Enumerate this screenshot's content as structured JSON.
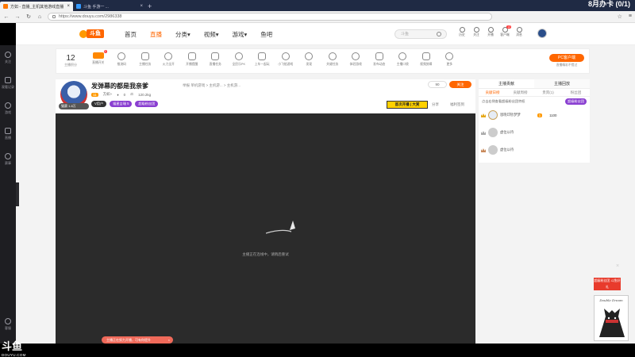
{
  "browser": {
    "tabs": [
      {
        "title": "方如 - 直播_主机其他游戏直播"
      },
      {
        "title": "斗鱼 手游一 ..."
      }
    ],
    "new_tab": "+",
    "address": "https://www.douyu.com/2986338",
    "overlay": "8月办卡 (0/1)"
  },
  "site": {
    "logo_text": "斗鱼",
    "nav": [
      {
        "label": "首页"
      },
      {
        "label": "直播"
      },
      {
        "label": "分类▾"
      },
      {
        "label": "视频▾"
      },
      {
        "label": "游戏▾"
      },
      {
        "label": "鱼吧"
      }
    ],
    "search_placeholder": "斗鱼",
    "header_tools": [
      {
        "label": "历史"
      },
      {
        "label": "关注"
      },
      {
        "label": "开播"
      },
      {
        "label": "客户端",
        "badge": "12"
      },
      {
        "label": "消息"
      }
    ]
  },
  "left_sidebar": {
    "items": [
      {
        "label": "关注"
      },
      {
        "label": "观看记录"
      },
      {
        "label": "游戏"
      },
      {
        "label": "直播"
      },
      {
        "label": "赛事"
      }
    ],
    "bottom": {
      "label": "客服"
    }
  },
  "toolbar": {
    "level_number": "12",
    "level_label": "主播积分",
    "items": [
      {
        "label": "直播开关",
        "badge": "3"
      },
      {
        "label": "推流码"
      },
      {
        "label": "主播任务"
      },
      {
        "label": "火力全开"
      },
      {
        "label": "开播提醒"
      },
      {
        "label": "直播任务"
      },
      {
        "label": "全民乐PK"
      },
      {
        "label": "上车一起玩"
      },
      {
        "label": "小飞船游戏"
      },
      {
        "label": "发现"
      },
      {
        "label": "关键任务"
      },
      {
        "label": "体验游戏"
      },
      {
        "label": "发布动态"
      },
      {
        "label": "主播口袋"
      },
      {
        "label": "视频剪辑"
      },
      {
        "label": "更多"
      }
    ],
    "pc_button": "PC客户端",
    "pc_sub": "直播精彩不错过"
  },
  "room": {
    "title": "发弹幕的都是我亲爹",
    "meta": "举报   单机游戏 > 主机游... > 主机游...",
    "level": "11",
    "anchor_name": "方如~",
    "fans": "0",
    "heat": "120.2kg",
    "anchor_badge": "猫赛 1.8万",
    "pills": [
      "V用户",
      "福星吉瑞 5",
      "超级粉丝团"
    ],
    "follow_count": "90",
    "follow_label": "关注",
    "promo": "首次开播 | 大赏",
    "share": "分享",
    "report": "福利签到"
  },
  "player": {
    "offline_message": "主播正在连线中，请稍后重试",
    "toast": "主播正在努力开播，可有你提升"
  },
  "right_panel": {
    "tabs1": [
      "主播贡献",
      "主播回放"
    ],
    "tabs2": [
      "贡献日榜",
      "贡献周榜",
      "贵宾(1)",
      "粉丝团"
    ],
    "notice": "点击右侧查看超级粉丝团特权",
    "fan_button": "超级粉丝团",
    "rank": [
      {
        "name": "恩晓印钞梦梦",
        "badge": "1",
        "score": "1100"
      },
      {
        "name": "虚位以待"
      },
      {
        "name": "虚位以待"
      }
    ]
  },
  "right_float": {
    "banner": "超级粉丝团 斗鱼好礼",
    "card_name": "Double Dream",
    "close": "×"
  },
  "watermark": {
    "big": "斗鱼",
    "small": "DOUYU.COM"
  },
  "colors": {
    "accent": "#ff6600",
    "tab_bg": "#1f2a44",
    "sidebar": "#1e1e22"
  }
}
